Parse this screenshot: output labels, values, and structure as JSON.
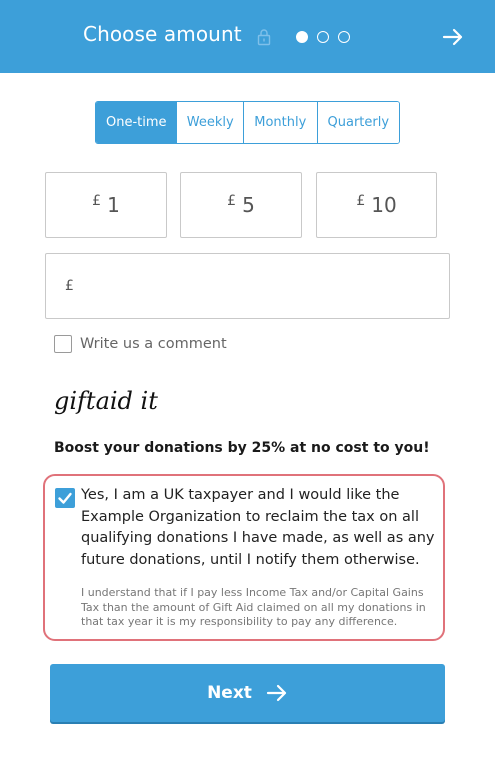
{
  "header": {
    "title": "Choose amount",
    "icons": {
      "lock": "lock-icon",
      "next": "arrow-right-icon"
    },
    "steps": [
      {
        "active": true
      },
      {
        "active": false
      },
      {
        "active": false
      }
    ]
  },
  "frequency": {
    "tabs": [
      {
        "label": "One-time",
        "active": true
      },
      {
        "label": "Weekly",
        "active": false
      },
      {
        "label": "Monthly",
        "active": false
      },
      {
        "label": "Quarterly",
        "active": false
      }
    ]
  },
  "amounts": [
    {
      "currency": "£",
      "value": "1"
    },
    {
      "currency": "£",
      "value": "5"
    },
    {
      "currency": "£",
      "value": "10"
    }
  ],
  "custom_amount": {
    "currency": "£",
    "value": ""
  },
  "comment": {
    "label": "Write us a comment",
    "checked": false
  },
  "giftaid": {
    "logo_text": "giftaid it",
    "boost_text": "Boost your donations by 25% at no cost to you!",
    "checked": true,
    "declaration": "Yes, I am a UK taxpayer and I would like the Example Organization to reclaim the tax on all qualifying donations I have made, as well as any future donations, until I notify them otherwise.",
    "disclaimer": "I understand that if I pay less Income Tax and/or Capital Gains Tax than the amount of Gift Aid claimed on all my donations in that tax year it is my responsibility to pay any difference."
  },
  "next_button": {
    "label": "Next",
    "icon": "arrow-right-icon"
  },
  "colors": {
    "primary": "#3d9fd9",
    "highlight_border": "#e0727a"
  }
}
